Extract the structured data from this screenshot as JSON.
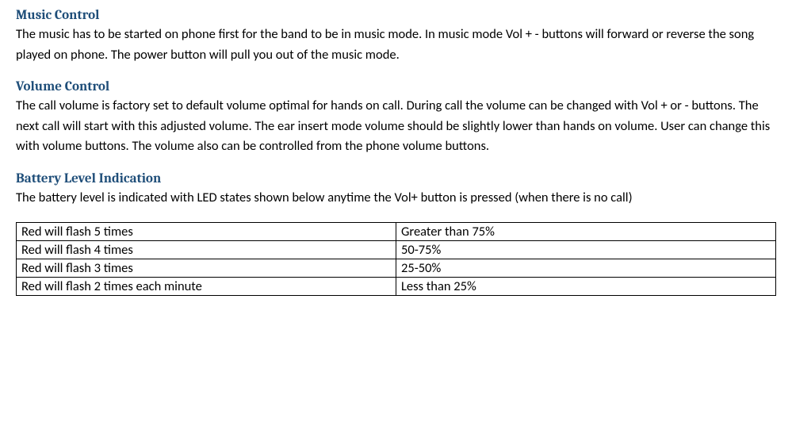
{
  "sections": {
    "music": {
      "heading": "Music Control",
      "body": "The music has to be started on phone first for the band to be in music mode. In music mode Vol + - buttons will forward or reverse the song played on phone. The power button will pull you out of the music mode."
    },
    "volume": {
      "heading": "Volume Control",
      "body": "The call volume is factory set to default volume optimal for hands on call. During call the volume can be changed with Vol + or - buttons. The next call will start with this adjusted volume. The ear insert mode volume should be slightly lower than hands on volume. User can change this with volume buttons. The volume also can be controlled from the phone volume buttons."
    },
    "battery": {
      "heading": "Battery Level Indication",
      "body": "The battery level is indicated with LED states shown below anytime the Vol+ button is pressed (when there is no call)"
    }
  },
  "battery_table": {
    "rows": [
      {
        "led": "Red will flash 5 times",
        "level": "Greater than 75%"
      },
      {
        "led": "Red will flash 4 times",
        "level": "50-75%"
      },
      {
        "led": "Red will flash 3 times",
        "level": "25-50%"
      },
      {
        "led": "Red will flash 2 times each minute",
        "level": "Less than 25%"
      }
    ]
  }
}
